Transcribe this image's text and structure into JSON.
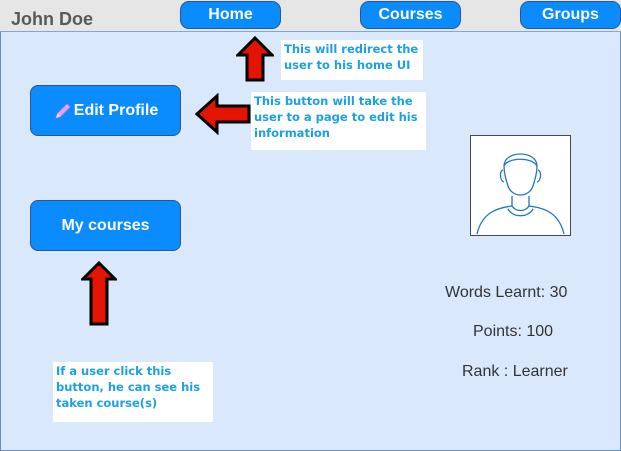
{
  "header": {
    "user_name": "John Doe",
    "nav": {
      "home": "Home",
      "courses": "Courses",
      "groups": "Groups"
    }
  },
  "actions": {
    "edit_profile": "Edit Profile",
    "my_courses": "My courses"
  },
  "annotations": {
    "home_note": "This will redirect the user to his home UI",
    "edit_note": "This button will take the user to a page to edit his information",
    "courses_note": "If a user click this button, he can see his taken course(s)"
  },
  "stats": {
    "words_learnt": "Words Learnt: 30",
    "points": "Points: 100",
    "rank": "Rank : Learner"
  },
  "icons": {
    "edit": "pencil-icon",
    "arrows": "red-arrow-icon",
    "profile": "user-avatar-icon"
  },
  "colors": {
    "background": "#dae8fc",
    "button": "#0a8cff",
    "note_text": "#1ba1e2",
    "arrow": "#e51400"
  }
}
